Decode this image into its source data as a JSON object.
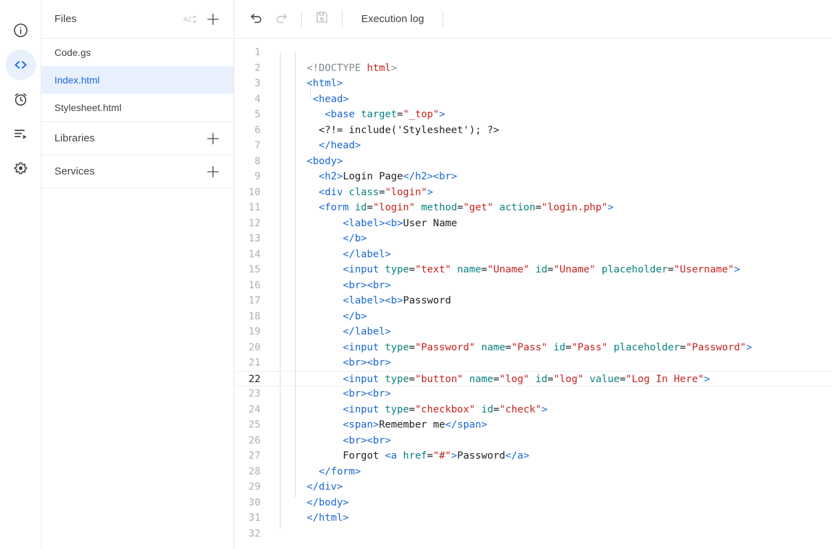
{
  "rail": {
    "items": [
      {
        "name": "overview-icon",
        "label": "Overview",
        "active": false
      },
      {
        "name": "code-editor-icon",
        "label": "Editor",
        "active": true
      },
      {
        "name": "triggers-clock-icon",
        "label": "Triggers",
        "active": false
      },
      {
        "name": "executions-icon",
        "label": "Executions",
        "active": false
      },
      {
        "name": "settings-gear-icon",
        "label": "Project Settings",
        "active": false
      }
    ]
  },
  "files_panel": {
    "header": {
      "title": "Files",
      "sort_icon": "sort-az-icon",
      "add_icon": "plus-icon"
    },
    "files": [
      {
        "name": "Code.gs",
        "selected": false
      },
      {
        "name": "Index.html",
        "selected": true
      },
      {
        "name": "Stylesheet.html",
        "selected": false
      }
    ],
    "sections": [
      {
        "title": "Libraries",
        "add_icon": "plus-icon"
      },
      {
        "title": "Services",
        "add_icon": "plus-icon"
      }
    ]
  },
  "toolbar": {
    "undo_icon": "undo-icon",
    "redo_icon": "redo-icon",
    "save_icon": "save-floppy-icon",
    "execution_log_label": "Execution log"
  },
  "editor": {
    "active_line": 22,
    "first_line": 1,
    "last_line": 32,
    "lines": [
      {
        "n": 1,
        "tokens": []
      },
      {
        "n": 2,
        "tokens": [
          {
            "c": "p",
            "s": "    "
          },
          {
            "c": "g",
            "s": "<!DOCTYPE "
          },
          {
            "c": "v",
            "s": "html"
          },
          {
            "c": "g",
            "s": ">"
          }
        ]
      },
      {
        "n": 3,
        "tokens": [
          {
            "c": "p",
            "s": "    "
          },
          {
            "c": "t",
            "s": "<html>"
          }
        ]
      },
      {
        "n": 4,
        "tokens": [
          {
            "c": "p",
            "s": "     "
          },
          {
            "c": "t",
            "s": "<head>"
          }
        ]
      },
      {
        "n": 5,
        "tokens": [
          {
            "c": "p",
            "s": "       "
          },
          {
            "c": "t",
            "s": "<base "
          },
          {
            "c": "a",
            "s": "target"
          },
          {
            "c": "p",
            "s": "="
          },
          {
            "c": "v",
            "s": "\"_top\""
          },
          {
            "c": "t",
            "s": ">"
          }
        ]
      },
      {
        "n": 6,
        "tokens": [
          {
            "c": "p",
            "s": "      <?!= include('Stylesheet'); ?>"
          }
        ]
      },
      {
        "n": 7,
        "tokens": [
          {
            "c": "p",
            "s": "      "
          },
          {
            "c": "t",
            "s": "</head>"
          }
        ]
      },
      {
        "n": 8,
        "tokens": [
          {
            "c": "p",
            "s": "    "
          },
          {
            "c": "t",
            "s": "<body>"
          }
        ]
      },
      {
        "n": 9,
        "tokens": [
          {
            "c": "p",
            "s": "      "
          },
          {
            "c": "t",
            "s": "<h2>"
          },
          {
            "c": "p",
            "s": "Login Page"
          },
          {
            "c": "t",
            "s": "</h2><br>"
          }
        ]
      },
      {
        "n": 10,
        "tokens": [
          {
            "c": "p",
            "s": "      "
          },
          {
            "c": "t",
            "s": "<div "
          },
          {
            "c": "a",
            "s": "class"
          },
          {
            "c": "p",
            "s": "="
          },
          {
            "c": "v",
            "s": "\"login\""
          },
          {
            "c": "t",
            "s": ">"
          }
        ]
      },
      {
        "n": 11,
        "tokens": [
          {
            "c": "p",
            "s": "      "
          },
          {
            "c": "t",
            "s": "<form "
          },
          {
            "c": "a",
            "s": "id"
          },
          {
            "c": "p",
            "s": "="
          },
          {
            "c": "v",
            "s": "\"login\""
          },
          {
            "c": "p",
            "s": " "
          },
          {
            "c": "a",
            "s": "method"
          },
          {
            "c": "p",
            "s": "="
          },
          {
            "c": "v",
            "s": "\"get\""
          },
          {
            "c": "p",
            "s": " "
          },
          {
            "c": "a",
            "s": "action"
          },
          {
            "c": "p",
            "s": "="
          },
          {
            "c": "v",
            "s": "\"login.php\""
          },
          {
            "c": "t",
            "s": ">"
          }
        ]
      },
      {
        "n": 12,
        "tokens": [
          {
            "c": "p",
            "s": "          "
          },
          {
            "c": "t",
            "s": "<label><b>"
          },
          {
            "c": "p",
            "s": "User Name"
          }
        ]
      },
      {
        "n": 13,
        "tokens": [
          {
            "c": "p",
            "s": "          "
          },
          {
            "c": "t",
            "s": "</b>"
          }
        ]
      },
      {
        "n": 14,
        "tokens": [
          {
            "c": "p",
            "s": "          "
          },
          {
            "c": "t",
            "s": "</label>"
          }
        ]
      },
      {
        "n": 15,
        "tokens": [
          {
            "c": "p",
            "s": "          "
          },
          {
            "c": "t",
            "s": "<input "
          },
          {
            "c": "a",
            "s": "type"
          },
          {
            "c": "p",
            "s": "="
          },
          {
            "c": "v",
            "s": "\"text\""
          },
          {
            "c": "p",
            "s": " "
          },
          {
            "c": "a",
            "s": "name"
          },
          {
            "c": "p",
            "s": "="
          },
          {
            "c": "v",
            "s": "\"Uname\""
          },
          {
            "c": "p",
            "s": " "
          },
          {
            "c": "a",
            "s": "id"
          },
          {
            "c": "p",
            "s": "="
          },
          {
            "c": "v",
            "s": "\"Uname\""
          },
          {
            "c": "p",
            "s": " "
          },
          {
            "c": "a",
            "s": "placeholder"
          },
          {
            "c": "p",
            "s": "="
          },
          {
            "c": "v",
            "s": "\"Username\""
          },
          {
            "c": "t",
            "s": ">"
          }
        ]
      },
      {
        "n": 16,
        "tokens": [
          {
            "c": "p",
            "s": "          "
          },
          {
            "c": "t",
            "s": "<br><br>"
          }
        ]
      },
      {
        "n": 17,
        "tokens": [
          {
            "c": "p",
            "s": "          "
          },
          {
            "c": "t",
            "s": "<label><b>"
          },
          {
            "c": "p",
            "s": "Password"
          }
        ]
      },
      {
        "n": 18,
        "tokens": [
          {
            "c": "p",
            "s": "          "
          },
          {
            "c": "t",
            "s": "</b>"
          }
        ]
      },
      {
        "n": 19,
        "tokens": [
          {
            "c": "p",
            "s": "          "
          },
          {
            "c": "t",
            "s": "</label>"
          }
        ]
      },
      {
        "n": 20,
        "tokens": [
          {
            "c": "p",
            "s": "          "
          },
          {
            "c": "t",
            "s": "<input "
          },
          {
            "c": "a",
            "s": "type"
          },
          {
            "c": "p",
            "s": "="
          },
          {
            "c": "v",
            "s": "\"Password\""
          },
          {
            "c": "p",
            "s": " "
          },
          {
            "c": "a",
            "s": "name"
          },
          {
            "c": "p",
            "s": "="
          },
          {
            "c": "v",
            "s": "\"Pass\""
          },
          {
            "c": "p",
            "s": " "
          },
          {
            "c": "a",
            "s": "id"
          },
          {
            "c": "p",
            "s": "="
          },
          {
            "c": "v",
            "s": "\"Pass\""
          },
          {
            "c": "p",
            "s": " "
          },
          {
            "c": "a",
            "s": "placeholder"
          },
          {
            "c": "p",
            "s": "="
          },
          {
            "c": "v",
            "s": "\"Password\""
          },
          {
            "c": "t",
            "s": ">"
          }
        ]
      },
      {
        "n": 21,
        "tokens": [
          {
            "c": "p",
            "s": "          "
          },
          {
            "c": "t",
            "s": "<br><br>"
          }
        ]
      },
      {
        "n": 22,
        "tokens": [
          {
            "c": "p",
            "s": "          "
          },
          {
            "c": "t",
            "s": "<input "
          },
          {
            "c": "a",
            "s": "type"
          },
          {
            "c": "p",
            "s": "="
          },
          {
            "c": "v",
            "s": "\"button\""
          },
          {
            "c": "p",
            "s": " "
          },
          {
            "c": "a",
            "s": "name"
          },
          {
            "c": "p",
            "s": "="
          },
          {
            "c": "v",
            "s": "\"log\""
          },
          {
            "c": "p",
            "s": " "
          },
          {
            "c": "a",
            "s": "id"
          },
          {
            "c": "p",
            "s": "="
          },
          {
            "c": "v",
            "s": "\"log\""
          },
          {
            "c": "p",
            "s": " "
          },
          {
            "c": "a",
            "s": "value"
          },
          {
            "c": "p",
            "s": "="
          },
          {
            "c": "v",
            "s": "\"Log In Here\""
          },
          {
            "c": "t",
            "s": ">"
          }
        ]
      },
      {
        "n": 23,
        "tokens": [
          {
            "c": "p",
            "s": "          "
          },
          {
            "c": "t",
            "s": "<br><br>"
          }
        ]
      },
      {
        "n": 24,
        "tokens": [
          {
            "c": "p",
            "s": "          "
          },
          {
            "c": "t",
            "s": "<input "
          },
          {
            "c": "a",
            "s": "type"
          },
          {
            "c": "p",
            "s": "="
          },
          {
            "c": "v",
            "s": "\"checkbox\""
          },
          {
            "c": "p",
            "s": " "
          },
          {
            "c": "a",
            "s": "id"
          },
          {
            "c": "p",
            "s": "="
          },
          {
            "c": "v",
            "s": "\"check\""
          },
          {
            "c": "t",
            "s": ">"
          }
        ]
      },
      {
        "n": 25,
        "tokens": [
          {
            "c": "p",
            "s": "          "
          },
          {
            "c": "t",
            "s": "<span>"
          },
          {
            "c": "p",
            "s": "Remember me"
          },
          {
            "c": "t",
            "s": "</span>"
          }
        ]
      },
      {
        "n": 26,
        "tokens": [
          {
            "c": "p",
            "s": "          "
          },
          {
            "c": "t",
            "s": "<br><br>"
          }
        ]
      },
      {
        "n": 27,
        "tokens": [
          {
            "c": "p",
            "s": "          Forgot "
          },
          {
            "c": "t",
            "s": "<a "
          },
          {
            "c": "a",
            "s": "href"
          },
          {
            "c": "p",
            "s": "="
          },
          {
            "c": "v",
            "s": "\"#\""
          },
          {
            "c": "t",
            "s": ">"
          },
          {
            "c": "p",
            "s": "Password"
          },
          {
            "c": "t",
            "s": "</a>"
          }
        ]
      },
      {
        "n": 28,
        "tokens": [
          {
            "c": "p",
            "s": "      "
          },
          {
            "c": "t",
            "s": "</form>"
          }
        ]
      },
      {
        "n": 29,
        "tokens": [
          {
            "c": "p",
            "s": "    "
          },
          {
            "c": "t",
            "s": "</div>"
          }
        ]
      },
      {
        "n": 30,
        "tokens": [
          {
            "c": "p",
            "s": "    "
          },
          {
            "c": "t",
            "s": "</body>"
          }
        ]
      },
      {
        "n": 31,
        "tokens": [
          {
            "c": "p",
            "s": "    "
          },
          {
            "c": "t",
            "s": "</html>"
          }
        ]
      },
      {
        "n": 32,
        "tokens": []
      }
    ]
  },
  "colors": {
    "accent": "#1a73e8",
    "selected_bg": "#e8f0fe",
    "selected_text": "#1967d2",
    "tag": "#1967d2",
    "attr": "#0a8080",
    "value": "#c5221f",
    "text": "#202124",
    "muted": "#80868b",
    "border": "#e8eaed"
  }
}
